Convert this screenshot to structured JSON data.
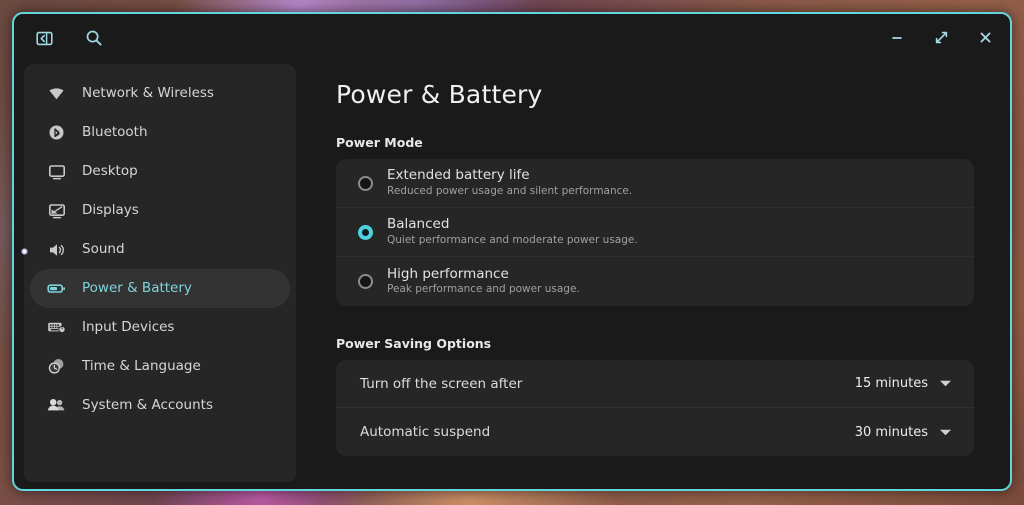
{
  "window": {
    "accent_color": "#62d5dd",
    "background": "#1a1a1a",
    "titlebar": {
      "sidebar_toggle_icon": "sidebar-toggle-icon",
      "search_icon": "search-icon",
      "minimize_label": "–",
      "maximize_label": "⤢",
      "close_label": "✕"
    }
  },
  "sidebar": {
    "items": [
      {
        "label": "Network & Wireless",
        "icon": "wifi-icon",
        "selected": false
      },
      {
        "label": "Bluetooth",
        "icon": "bluetooth-icon",
        "selected": false
      },
      {
        "label": "Desktop",
        "icon": "monitor-icon",
        "selected": false
      },
      {
        "label": "Displays",
        "icon": "display-icon",
        "selected": false
      },
      {
        "label": "Sound",
        "icon": "speaker-icon",
        "selected": false
      },
      {
        "label": "Power & Battery",
        "icon": "battery-icon",
        "selected": true
      },
      {
        "label": "Input Devices",
        "icon": "keyboard-icon",
        "selected": false
      },
      {
        "label": "Time & Language",
        "icon": "clock-icon",
        "selected": false
      },
      {
        "label": "System & Accounts",
        "icon": "users-icon",
        "selected": false
      }
    ]
  },
  "main": {
    "title": "Power & Battery",
    "power_mode": {
      "section_label": "Power Mode",
      "options": [
        {
          "title": "Extended battery life",
          "desc": "Reduced power usage and silent performance.",
          "selected": false
        },
        {
          "title": "Balanced",
          "desc": "Quiet performance and moderate power usage.",
          "selected": true
        },
        {
          "title": "High performance",
          "desc": "Peak performance and power usage.",
          "selected": false
        }
      ]
    },
    "power_saving": {
      "section_label": "Power Saving Options",
      "rows": [
        {
          "label": "Turn off the screen after",
          "value": "15 minutes"
        },
        {
          "label": "Automatic suspend",
          "value": "30 minutes"
        }
      ]
    }
  }
}
